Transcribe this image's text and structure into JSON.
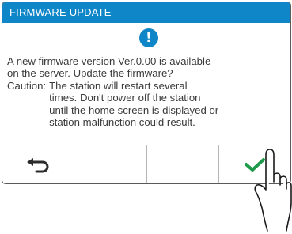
{
  "dialog": {
    "title": "FIRMWARE UPDATE",
    "alert_icon": "exclamation-circle-icon",
    "alert_glyph": "!",
    "message_line1": "A new firmware version Ver.0.00 is available",
    "message_line2": "on the server. Update the firmware?",
    "caution_label": "Caution:",
    "caution_lines": [
      "The station will restart several",
      "times. Don't power off the station",
      "until the home screen is displayed or",
      "station malfunction could result."
    ]
  },
  "buttons": [
    {
      "name": "back-button",
      "icon": "return-arrow-icon"
    },
    {
      "name": "empty-button-2",
      "icon": ""
    },
    {
      "name": "empty-button-3",
      "icon": ""
    },
    {
      "name": "confirm-button",
      "icon": "checkmark-icon"
    }
  ],
  "colors": {
    "titlebar": "#0f86c8",
    "checkmark": "#1f9a4a",
    "text": "#3a3a3a"
  }
}
